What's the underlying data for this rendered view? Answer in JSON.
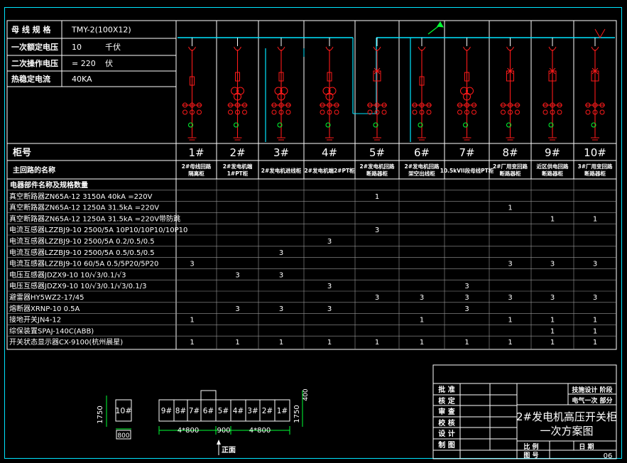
{
  "header_params": [
    {
      "label": "母 线 规 格",
      "value": "TMY-2(100X12)",
      "unit": ""
    },
    {
      "label": "一次额定电压",
      "value": "10",
      "unit": "千伏"
    },
    {
      "label": "二次操作电压",
      "value": "= 220",
      "unit": "伏"
    },
    {
      "label": "热稳定电流",
      "value": "40KA",
      "unit": ""
    }
  ],
  "cabinet_row_label": "柜号",
  "cabinets": [
    "1#",
    "2#",
    "3#",
    "4#",
    "5#",
    "6#",
    "7#",
    "8#",
    "9#",
    "10#"
  ],
  "circuit_row_label": "主回路的名称",
  "circuit_names": [
    "2#母线回路\n隔离柜",
    "2#发电机端\n1#PT柜",
    "2#发电机进线柜",
    "2#发电机端2#PT柜",
    "2#发电机回路\n断路器柜",
    "2#发电机回路\n架空出线柜",
    "10.5kVII段母线PT柜",
    "2#厂用变回路\n断路器柜",
    "近区供电回路\n断路器柜",
    "3#厂用变回路\n断路器柜"
  ],
  "parts_header": "电器部件名称及规格数量",
  "parts": [
    {
      "name": "真空断路器ZN65A-12  3150A  40kA  =220V",
      "qty": [
        "",
        "",
        "",
        "",
        "1",
        "",
        "",
        "",
        "",
        ""
      ]
    },
    {
      "name": "真空断路器ZN65A-12  1250A  31.5kA  =220V",
      "qty": [
        "",
        "",
        "",
        "",
        "",
        "",
        "",
        "1",
        "",
        ""
      ]
    },
    {
      "name": "真空断路器ZN65A-12  1250A  31.5kA  =220V带防跳",
      "qty": [
        "",
        "",
        "",
        "",
        "",
        "",
        "",
        "",
        "1",
        "1"
      ]
    },
    {
      "name": "电流互感器LZZBJ9-10  2500/5A  10P10/10P10/10P10",
      "qty": [
        "",
        "",
        "",
        "",
        "3",
        "",
        "",
        "",
        "",
        ""
      ]
    },
    {
      "name": "电流互感器LZZBJ9-10    2500/5A   0.2/0.5/0.5",
      "qty": [
        "",
        "",
        "",
        "3",
        "",
        "",
        "",
        "",
        "",
        ""
      ]
    },
    {
      "name": "电流互感器LZZBJ9-10    2500/5A   0.5/0.5/0.5",
      "qty": [
        "",
        "",
        "3",
        "",
        "",
        "",
        "",
        "",
        "",
        ""
      ]
    },
    {
      "name": "电流互感器LZZBJ9-10    60/5A    0.5/5P20/5P20",
      "qty": [
        "3",
        "",
        "",
        "",
        "",
        "",
        "",
        "3",
        "3",
        "3"
      ]
    },
    {
      "name": "电压互感器JDZX9-10  10/√3/0.1/√3",
      "qty": [
        "",
        "3",
        "3",
        "",
        "",
        "",
        "",
        "",
        "",
        ""
      ]
    },
    {
      "name": "电压互感器JDZX9-10  10/√3/0.1/√3/0.1/3",
      "qty": [
        "",
        "",
        "",
        "3",
        "",
        "",
        "3",
        "",
        "",
        ""
      ]
    },
    {
      "name": "避雷器HY5WZ2-17/45",
      "qty": [
        "",
        "",
        "",
        "",
        "3",
        "3",
        "3",
        "3",
        "3",
        "3"
      ]
    },
    {
      "name": "熔断器XRNP-10  0.5A",
      "qty": [
        "",
        "3",
        "3",
        "3",
        "",
        "",
        "3",
        "",
        "",
        ""
      ]
    },
    {
      "name": "接地开关JN4-12",
      "qty": [
        "1",
        "",
        "",
        "",
        "",
        "1",
        "",
        "1",
        "1",
        "1"
      ]
    },
    {
      "name": "综保装置SPAJ-140C(ABB)",
      "qty": [
        "",
        "",
        "",
        "",
        "",
        "",
        "",
        "",
        "1",
        "1"
      ]
    },
    {
      "name": "开关状态显示器CX-9100(杭州晨星)",
      "qty": [
        "1",
        "1",
        "1",
        "1",
        "1",
        "1",
        "1",
        "1",
        "1",
        "1"
      ]
    }
  ],
  "layout_plan": {
    "depth_label": "1750",
    "width_label_single": "800",
    "span_label_left": "4*800",
    "span_label_mid": "900",
    "span_label_right": "4*800",
    "height_label_right": "1750",
    "top_label_right": "400",
    "front_label": "正面",
    "single_cabinet": "10#",
    "row_cabinets": [
      "9#",
      "8#",
      "7#",
      "6#",
      "5#",
      "4#",
      "3#",
      "2#",
      "1#"
    ]
  },
  "title_block": {
    "rows": [
      "批  准",
      "核  定",
      "审  查",
      "校  核",
      "设  计",
      "制  图"
    ],
    "design_company": "技施设计  阶段",
    "discipline": "电气一次  部分",
    "title_line1": "2#发电机高压开关柜",
    "title_line2": "一次方案图",
    "scale_label": "比  例",
    "date_label": "日  期",
    "drawing_no_label": "图  号",
    "drawing_no": "06"
  }
}
